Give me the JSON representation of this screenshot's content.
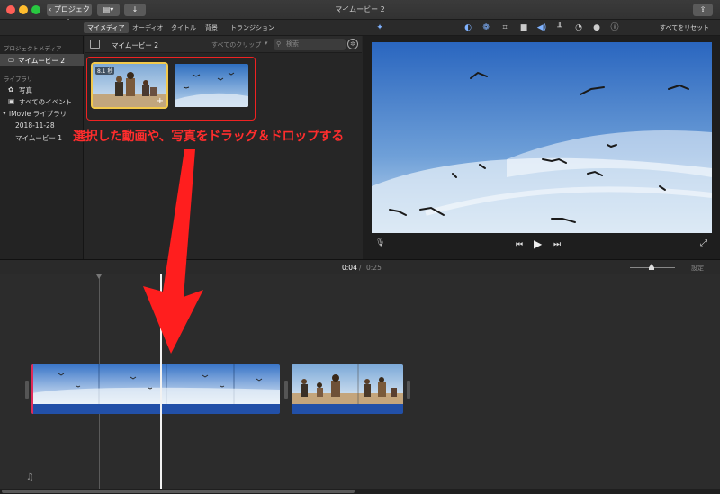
{
  "window": {
    "title": "マイムービー 2",
    "back_label": "プロジェクト"
  },
  "toolbar": {
    "tabs": [
      "マイメディア",
      "オーディオ",
      "タイトル",
      "背景",
      "トランジション"
    ],
    "reset_label": "すべてをリセット"
  },
  "sidebar": {
    "project_header": "プロジェクトメディア",
    "project_item": "マイムービー 2",
    "library_header": "ライブラリ",
    "items": [
      "写真",
      "すべてのイベント"
    ],
    "library_name": "iMovie ライブラリ",
    "events": [
      "2018-11-28",
      "マイムービー 1"
    ]
  },
  "browser": {
    "project_title": "マイムービー 2",
    "filter_label": "すべてのクリップ",
    "search_placeholder": "検索",
    "clip_duration": "8.1 秒"
  },
  "viewer": {},
  "timecode": {
    "current": "0:04",
    "separator": "/",
    "total": "0:25",
    "settings_label": "設定"
  },
  "annotation": {
    "text": "選択した動画や、写真をドラッグ＆ドロップする"
  },
  "colors": {
    "accent": "#f2c94c",
    "annotation": "#ff2d2d",
    "audio": "#2250a8",
    "tool_blue": "#7fb2ff"
  }
}
